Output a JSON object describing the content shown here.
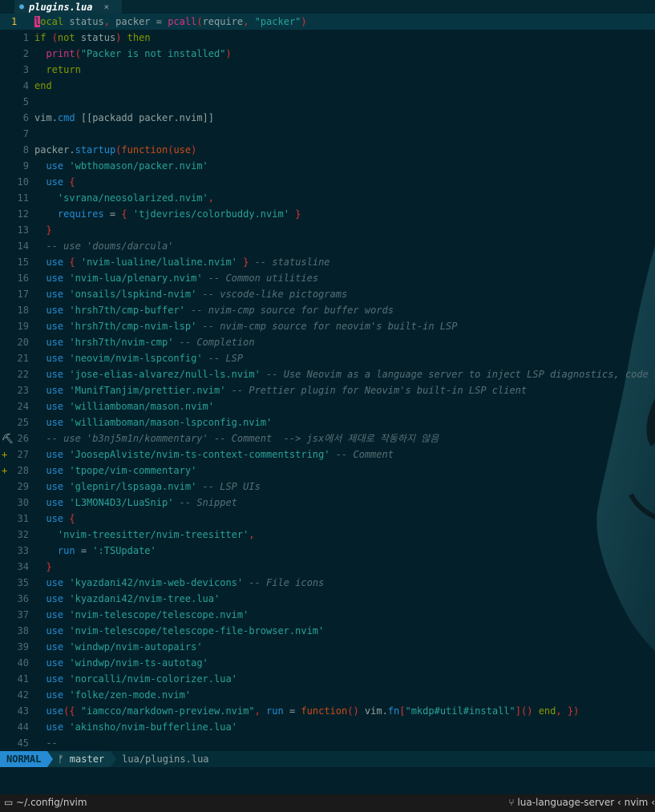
{
  "tab": {
    "icon": "lua-file-icon",
    "name": "plugins.lua",
    "close": "×"
  },
  "lines": [
    {
      "num": "1",
      "current": true,
      "sign": "",
      "tokens": [
        [
          "cursor",
          "l"
        ],
        [
          "k",
          "ocal"
        ],
        [
          "d",
          " status"
        ],
        [
          "p",
          ","
        ],
        [
          "d",
          " packer "
        ],
        [
          "d",
          "= "
        ],
        [
          "f",
          "pcall"
        ],
        [
          "p",
          "("
        ],
        [
          "d",
          "require"
        ],
        [
          "p",
          ","
        ],
        [
          "s",
          " \"packer\""
        ],
        [
          "p",
          ")"
        ]
      ]
    },
    {
      "num": "1",
      "sign": "",
      "tokens": [
        [
          "k",
          "if"
        ],
        [
          "d",
          " "
        ],
        [
          "p",
          "("
        ],
        [
          "k",
          "not"
        ],
        [
          "d",
          " status"
        ],
        [
          "p",
          ")"
        ],
        [
          "d",
          " "
        ],
        [
          "k",
          "then"
        ]
      ]
    },
    {
      "num": "2",
      "sign": "",
      "tokens": [
        [
          "d",
          "  "
        ],
        [
          "f",
          "print"
        ],
        [
          "p",
          "("
        ],
        [
          "s",
          "\"Packer is not installed\""
        ],
        [
          "p",
          ")"
        ]
      ]
    },
    {
      "num": "3",
      "sign": "",
      "tokens": [
        [
          "d",
          "  "
        ],
        [
          "k",
          "return"
        ]
      ]
    },
    {
      "num": "4",
      "sign": "",
      "tokens": [
        [
          "k",
          "end"
        ]
      ]
    },
    {
      "num": "5",
      "sign": "",
      "tokens": []
    },
    {
      "num": "6",
      "sign": "",
      "tokens": [
        [
          "d",
          "vim"
        ],
        [
          "d",
          "."
        ],
        [
          "b",
          "cmd"
        ],
        [
          "d",
          " "
        ],
        [
          "d",
          "[[packadd packer.nvim]]"
        ]
      ]
    },
    {
      "num": "7",
      "sign": "",
      "tokens": []
    },
    {
      "num": "8",
      "sign": "",
      "tokens": [
        [
          "d",
          "packer"
        ],
        [
          "d",
          "."
        ],
        [
          "b",
          "startup"
        ],
        [
          "p",
          "("
        ],
        [
          "o",
          "function"
        ],
        [
          "p",
          "("
        ],
        [
          "o",
          "use"
        ],
        [
          "p",
          ")"
        ]
      ]
    },
    {
      "num": "9",
      "sign": "",
      "tokens": [
        [
          "d",
          "  "
        ],
        [
          "b",
          "use"
        ],
        [
          "d",
          " "
        ],
        [
          "s",
          "'wbthomason/packer.nvim'"
        ]
      ]
    },
    {
      "num": "10",
      "sign": "",
      "tokens": [
        [
          "d",
          "  "
        ],
        [
          "b",
          "use"
        ],
        [
          "d",
          " "
        ],
        [
          "p",
          "{"
        ]
      ]
    },
    {
      "num": "11",
      "sign": "",
      "tokens": [
        [
          "d",
          "    "
        ],
        [
          "s",
          "'svrana/neosolarized.nvim'"
        ],
        [
          "p",
          ","
        ]
      ]
    },
    {
      "num": "12",
      "sign": "",
      "tokens": [
        [
          "d",
          "    "
        ],
        [
          "b",
          "requires"
        ],
        [
          "d",
          " = "
        ],
        [
          "p",
          "{"
        ],
        [
          "d",
          " "
        ],
        [
          "s",
          "'tjdevries/colorbuddy.nvim'"
        ],
        [
          "d",
          " "
        ],
        [
          "p",
          "}"
        ]
      ]
    },
    {
      "num": "13",
      "sign": "",
      "tokens": [
        [
          "d",
          "  "
        ],
        [
          "p",
          "}"
        ]
      ]
    },
    {
      "num": "14",
      "sign": "",
      "tokens": [
        [
          "c",
          "  -- use 'doums/darcula'"
        ]
      ]
    },
    {
      "num": "15",
      "sign": "",
      "tokens": [
        [
          "d",
          "  "
        ],
        [
          "b",
          "use"
        ],
        [
          "d",
          " "
        ],
        [
          "p",
          "{"
        ],
        [
          "d",
          " "
        ],
        [
          "s",
          "'nvim-lualine/lualine.nvim'"
        ],
        [
          "d",
          " "
        ],
        [
          "p",
          "}"
        ],
        [
          "c",
          " -- statusline"
        ]
      ]
    },
    {
      "num": "16",
      "sign": "",
      "tokens": [
        [
          "d",
          "  "
        ],
        [
          "b",
          "use"
        ],
        [
          "d",
          " "
        ],
        [
          "s",
          "'nvim-lua/plenary.nvim'"
        ],
        [
          "c",
          " -- Common utilities"
        ]
      ]
    },
    {
      "num": "17",
      "sign": "",
      "tokens": [
        [
          "d",
          "  "
        ],
        [
          "b",
          "use"
        ],
        [
          "d",
          " "
        ],
        [
          "s",
          "'onsails/lspkind-nvim'"
        ],
        [
          "c",
          " -- vscode-like pictograms"
        ]
      ]
    },
    {
      "num": "18",
      "sign": "",
      "tokens": [
        [
          "d",
          "  "
        ],
        [
          "b",
          "use"
        ],
        [
          "d",
          " "
        ],
        [
          "s",
          "'hrsh7th/cmp-buffer'"
        ],
        [
          "c",
          " -- nvim-cmp source for buffer words"
        ]
      ]
    },
    {
      "num": "19",
      "sign": "",
      "tokens": [
        [
          "d",
          "  "
        ],
        [
          "b",
          "use"
        ],
        [
          "d",
          " "
        ],
        [
          "s",
          "'hrsh7th/cmp-nvim-lsp'"
        ],
        [
          "c",
          " -- nvim-cmp source for neovim's built-in LSP"
        ]
      ]
    },
    {
      "num": "20",
      "sign": "",
      "tokens": [
        [
          "d",
          "  "
        ],
        [
          "b",
          "use"
        ],
        [
          "d",
          " "
        ],
        [
          "s",
          "'hrsh7th/nvim-cmp'"
        ],
        [
          "c",
          " -- Completion"
        ]
      ]
    },
    {
      "num": "21",
      "sign": "",
      "tokens": [
        [
          "d",
          "  "
        ],
        [
          "b",
          "use"
        ],
        [
          "d",
          " "
        ],
        [
          "s",
          "'neovim/nvim-lspconfig'"
        ],
        [
          "c",
          " -- LSP"
        ]
      ]
    },
    {
      "num": "22",
      "sign": "",
      "tokens": [
        [
          "d",
          "  "
        ],
        [
          "b",
          "use"
        ],
        [
          "d",
          " "
        ],
        [
          "s",
          "'jose-elias-alvarez/null-ls.nvim'"
        ],
        [
          "c",
          " -- Use Neovim as a language server to inject LSP diagnostics, code acti"
        ]
      ]
    },
    {
      "num": "23",
      "sign": "",
      "tokens": [
        [
          "d",
          "  "
        ],
        [
          "b",
          "use"
        ],
        [
          "d",
          " "
        ],
        [
          "s",
          "'MunifTanjim/prettier.nvim'"
        ],
        [
          "c",
          " -- Prettier plugin for Neovim's built-in LSP client"
        ]
      ]
    },
    {
      "num": "24",
      "sign": "",
      "tokens": [
        [
          "d",
          "  "
        ],
        [
          "b",
          "use"
        ],
        [
          "d",
          " "
        ],
        [
          "s",
          "'williamboman/mason.nvim'"
        ]
      ]
    },
    {
      "num": "25",
      "sign": "",
      "tokens": [
        [
          "d",
          "  "
        ],
        [
          "b",
          "use"
        ],
        [
          "d",
          " "
        ],
        [
          "s",
          "'williamboman/mason-lspconfig.nvim'"
        ]
      ]
    },
    {
      "num": "26",
      "sign": "⛏",
      "signClass": "tool",
      "tokens": [
        [
          "c",
          "  -- use 'b3nj5m1n/kommentary' -- Comment  --> jsx에서 제대로 작동하지 않음"
        ]
      ]
    },
    {
      "num": "27",
      "sign": "+",
      "tokens": [
        [
          "d",
          "  "
        ],
        [
          "b",
          "use"
        ],
        [
          "d",
          " "
        ],
        [
          "s",
          "'JoosepAlviste/nvim-ts-context-commentstring'"
        ],
        [
          "c",
          " -- Comment"
        ]
      ]
    },
    {
      "num": "28",
      "sign": "+",
      "tokens": [
        [
          "d",
          "  "
        ],
        [
          "b",
          "use"
        ],
        [
          "d",
          " "
        ],
        [
          "s",
          "'tpope/vim-commentary'"
        ]
      ]
    },
    {
      "num": "29",
      "sign": "",
      "tokens": [
        [
          "d",
          "  "
        ],
        [
          "b",
          "use"
        ],
        [
          "d",
          " "
        ],
        [
          "s",
          "'glepnir/lspsaga.nvim'"
        ],
        [
          "c",
          " -- LSP UIs"
        ]
      ]
    },
    {
      "num": "30",
      "sign": "",
      "tokens": [
        [
          "d",
          "  "
        ],
        [
          "b",
          "use"
        ],
        [
          "d",
          " "
        ],
        [
          "s",
          "'L3MON4D3/LuaSnip'"
        ],
        [
          "c",
          " -- Snippet"
        ]
      ]
    },
    {
      "num": "31",
      "sign": "",
      "tokens": [
        [
          "d",
          "  "
        ],
        [
          "b",
          "use"
        ],
        [
          "d",
          " "
        ],
        [
          "p",
          "{"
        ]
      ]
    },
    {
      "num": "32",
      "sign": "",
      "tokens": [
        [
          "d",
          "    "
        ],
        [
          "s",
          "'nvim-treesitter/nvim-treesitter'"
        ],
        [
          "p",
          ","
        ]
      ]
    },
    {
      "num": "33",
      "sign": "",
      "tokens": [
        [
          "d",
          "    "
        ],
        [
          "b",
          "run"
        ],
        [
          "d",
          " = "
        ],
        [
          "s",
          "':TSUpdate'"
        ]
      ]
    },
    {
      "num": "34",
      "sign": "",
      "tokens": [
        [
          "d",
          "  "
        ],
        [
          "p",
          "}"
        ]
      ]
    },
    {
      "num": "35",
      "sign": "",
      "tokens": [
        [
          "d",
          "  "
        ],
        [
          "b",
          "use"
        ],
        [
          "d",
          " "
        ],
        [
          "s",
          "'kyazdani42/nvim-web-devicons'"
        ],
        [
          "c",
          " -- File icons"
        ]
      ]
    },
    {
      "num": "36",
      "sign": "",
      "tokens": [
        [
          "d",
          "  "
        ],
        [
          "b",
          "use"
        ],
        [
          "d",
          " "
        ],
        [
          "s",
          "'kyazdani42/nvim-tree.lua'"
        ]
      ]
    },
    {
      "num": "37",
      "sign": "",
      "tokens": [
        [
          "d",
          "  "
        ],
        [
          "b",
          "use"
        ],
        [
          "d",
          " "
        ],
        [
          "s",
          "'nvim-telescope/telescope.nvim'"
        ]
      ]
    },
    {
      "num": "38",
      "sign": "",
      "tokens": [
        [
          "d",
          "  "
        ],
        [
          "b",
          "use"
        ],
        [
          "d",
          " "
        ],
        [
          "s",
          "'nvim-telescope/telescope-file-browser.nvim'"
        ]
      ]
    },
    {
      "num": "39",
      "sign": "",
      "tokens": [
        [
          "d",
          "  "
        ],
        [
          "b",
          "use"
        ],
        [
          "d",
          " "
        ],
        [
          "s",
          "'windwp/nvim-autopairs'"
        ]
      ]
    },
    {
      "num": "40",
      "sign": "",
      "tokens": [
        [
          "d",
          "  "
        ],
        [
          "b",
          "use"
        ],
        [
          "d",
          " "
        ],
        [
          "s",
          "'windwp/nvim-ts-autotag'"
        ]
      ]
    },
    {
      "num": "41",
      "sign": "",
      "tokens": [
        [
          "d",
          "  "
        ],
        [
          "b",
          "use"
        ],
        [
          "d",
          " "
        ],
        [
          "s",
          "'norcalli/nvim-colorizer.lua'"
        ]
      ]
    },
    {
      "num": "42",
      "sign": "",
      "tokens": [
        [
          "d",
          "  "
        ],
        [
          "b",
          "use"
        ],
        [
          "d",
          " "
        ],
        [
          "s",
          "'folke/zen-mode.nvim'"
        ]
      ]
    },
    {
      "num": "43",
      "sign": "",
      "tokens": [
        [
          "d",
          "  "
        ],
        [
          "b",
          "use"
        ],
        [
          "p",
          "({"
        ],
        [
          "d",
          " "
        ],
        [
          "s",
          "\"iamcco/markdown-preview.nvim\""
        ],
        [
          "p",
          ","
        ],
        [
          "d",
          " "
        ],
        [
          "b",
          "run"
        ],
        [
          "d",
          " = "
        ],
        [
          "o",
          "function"
        ],
        [
          "p",
          "()"
        ],
        [
          "d",
          " vim."
        ],
        [
          "b",
          "fn"
        ],
        [
          "p",
          "["
        ],
        [
          "s",
          "\"mkdp#util#install\""
        ],
        [
          "p",
          "]"
        ],
        [
          "p",
          "()"
        ],
        [
          "d",
          " "
        ],
        [
          "k",
          "end"
        ],
        [
          "p",
          ","
        ],
        [
          "d",
          " "
        ],
        [
          "p",
          "})"
        ]
      ]
    },
    {
      "num": "44",
      "sign": "",
      "tokens": [
        [
          "d",
          "  "
        ],
        [
          "b",
          "use"
        ],
        [
          "d",
          " "
        ],
        [
          "s",
          "'akinsho/nvim-bufferline.lua'"
        ]
      ]
    },
    {
      "num": "45",
      "sign": "",
      "tokens": [
        [
          "c",
          "  --"
        ]
      ]
    }
  ],
  "statusline": {
    "mode": "NORMAL",
    "branch_icon": "ᚠ",
    "branch": "master",
    "file": "lua/plugins.lua"
  },
  "terminal": {
    "folder_icon": "folder-icon",
    "cwd": "~/.config/nvim",
    "right": "lua-language-server ‹ nvim ‹"
  },
  "colors": {
    "background": "#03202a",
    "mode_bg": "#268bd2",
    "string": "#2aa198",
    "keyword": "#859900",
    "comment": "#586e75"
  }
}
